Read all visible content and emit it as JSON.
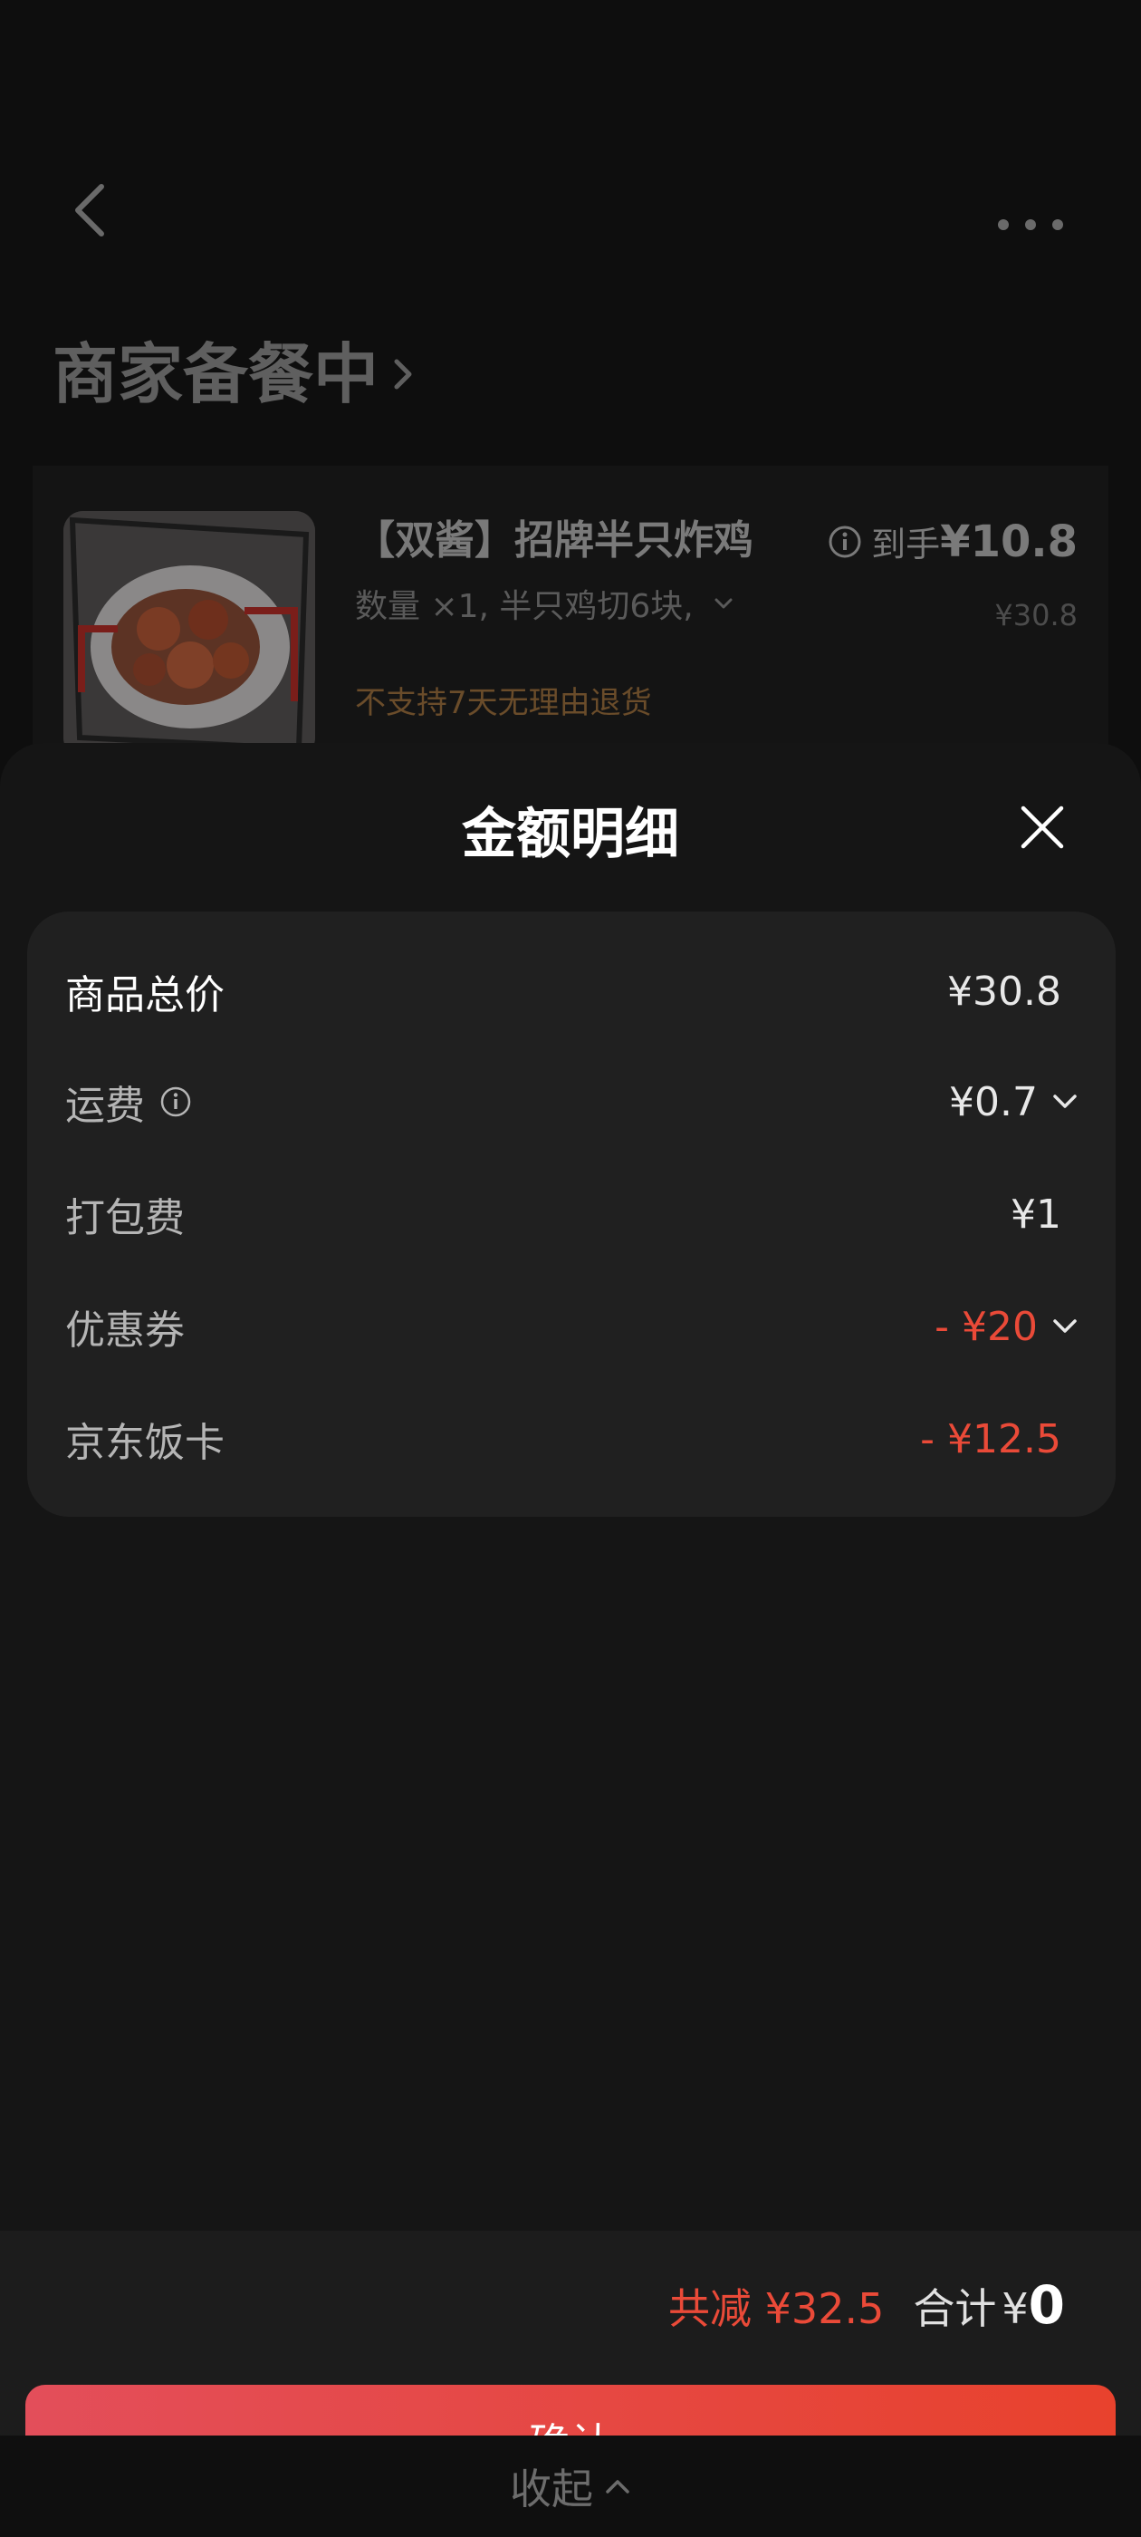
{
  "header": {
    "title": "商家备餐中"
  },
  "order_item": {
    "name": "【双酱】招牌半只炸鸡",
    "spec": "数量 ×1, 半只鸡切6块,",
    "note": "不支持7天无理由退货",
    "price_label": "到手",
    "price_value": "¥10.8",
    "original_price": "¥30.8"
  },
  "sheet": {
    "title": "金额明细",
    "rows": [
      {
        "label": "商品总价",
        "value": "¥30.8"
      },
      {
        "label": "运费",
        "value": "¥0.7"
      },
      {
        "label": "打包费",
        "value": "¥1"
      },
      {
        "label": "优惠券",
        "value": "- ¥20"
      },
      {
        "label": "京东饭卡",
        "value": "- ¥12.5"
      }
    ]
  },
  "footer": {
    "savings": "共减 ¥32.5",
    "total_label": "合计",
    "total_currency": "¥",
    "total_value": "0",
    "confirm_label": "确认",
    "collapse_label": "收起"
  },
  "colors": {
    "accent_red": "#ea4a38",
    "button_gradient_start": "#e34e5a",
    "button_gradient_end": "#e8422d"
  }
}
